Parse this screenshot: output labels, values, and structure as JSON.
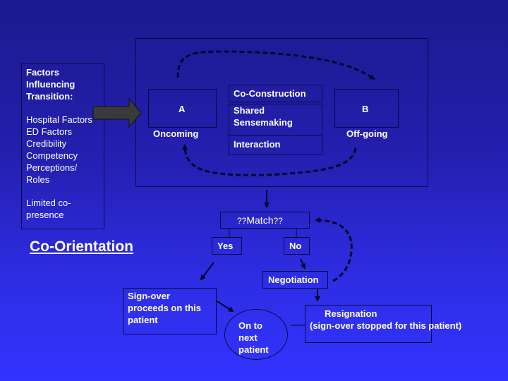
{
  "factors_panel": {
    "heading_lines": [
      "Factors",
      "Influencing",
      "Transition:"
    ],
    "items": [
      "Hospital Factors",
      "ED Factors",
      "Credibility",
      "Competency",
      "Perceptions/",
      "Roles"
    ],
    "extra_lines": [
      "Limited co-",
      "presence"
    ]
  },
  "section_label": "Co-Orientation",
  "transition_frame": {
    "node_a": {
      "letter": "A",
      "caption": "Oncoming"
    },
    "node_b": {
      "letter": "B",
      "caption": "Off-going"
    },
    "center_stack": {
      "rows": [
        "Co-Construction",
        "Shared Sensemaking",
        "Interaction"
      ],
      "shared_lines": [
        "Shared",
        "Sensemaking"
      ]
    }
  },
  "decision": {
    "match": {
      "prefix": "??",
      "word": "Match",
      "suffix": "??"
    },
    "yes": "Yes",
    "no": "No",
    "negotiation": "Negotiation"
  },
  "outcomes": {
    "signover_lines": [
      "Sign-over",
      "proceeds on this",
      "patient"
    ],
    "next_patient_lines": [
      "On to",
      "next",
      "patient"
    ],
    "resignation_lines": [
      "Resignation",
      "(sign-over stopped for this patient)"
    ]
  },
  "colors": {
    "background_top": "#1c1a8e",
    "background_bottom": "#3333ff",
    "border": "#0a0a40",
    "arrow_fill": "#3a3a3a",
    "text": "#ffffff"
  }
}
